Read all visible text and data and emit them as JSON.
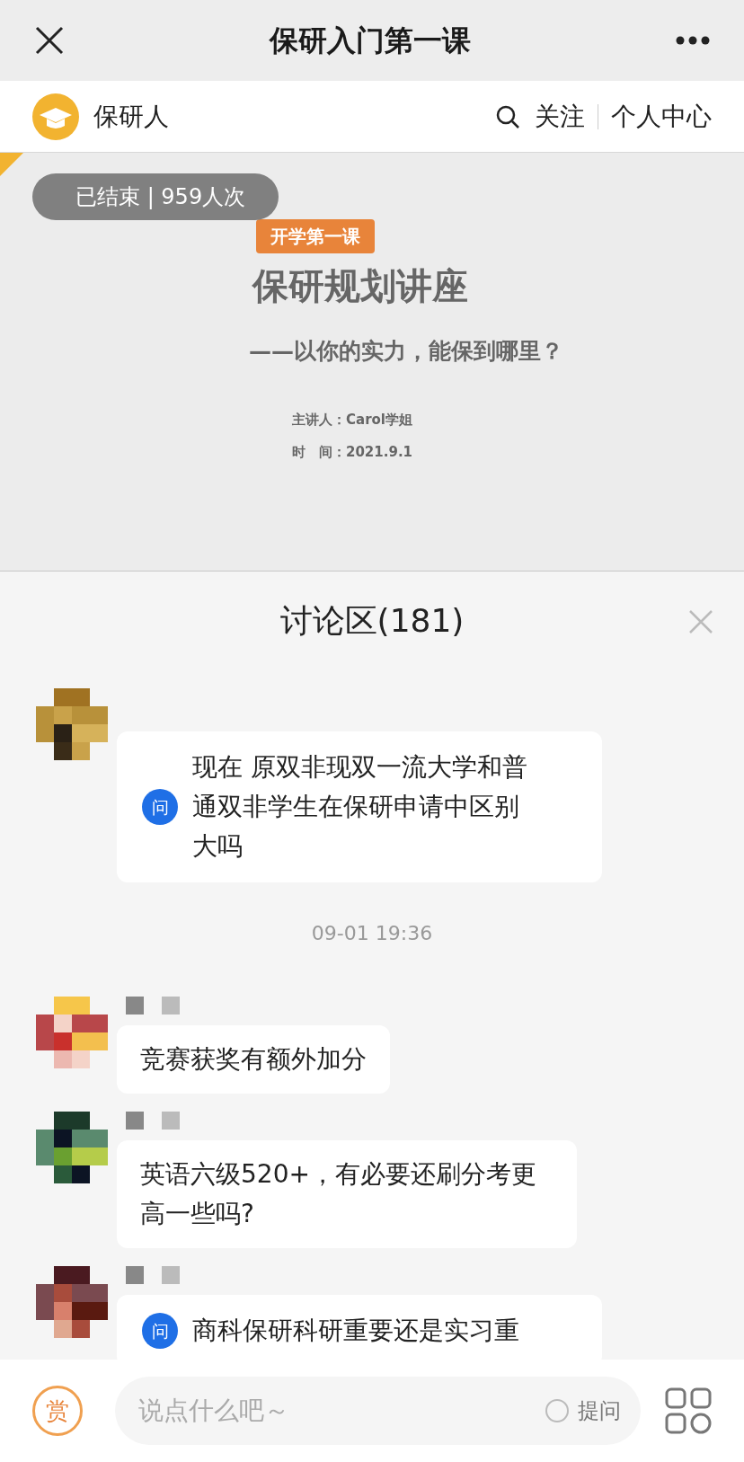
{
  "nav_bar": {
    "title": "保研入门第一课"
  },
  "channel_bar": {
    "name": "保研人",
    "follow": "关注",
    "profile": "个人中心"
  },
  "slide": {
    "status": "已结束 | 959人次",
    "tag": "开学第一课",
    "title": "保研规划讲座",
    "subtitle": "——以你的实力，能保到哪里？",
    "presenter": "主讲人：Carol学姐",
    "date": "时　间：2021.9.1"
  },
  "discussion": {
    "title": "讨论区(181)",
    "items": [
      {
        "kind": "message",
        "question": true,
        "badge": "问",
        "show_name": false,
        "text": "现在 原双非现双一流大学和普通双非学生在保研申请中区别大吗"
      },
      {
        "kind": "timestamp",
        "text": "09-01 19:36"
      },
      {
        "kind": "message",
        "question": false,
        "show_name": true,
        "text": "竞赛获奖有额外加分"
      },
      {
        "kind": "message",
        "question": false,
        "show_name": true,
        "text": "英语六级520+，有必要还刷分考更高一些吗?"
      },
      {
        "kind": "message",
        "question": true,
        "badge": "问",
        "show_name": true,
        "text": "商科保研科研重要还是实习重"
      }
    ]
  },
  "bottom_bar": {
    "reward": "赏",
    "placeholder": "说点什么吧～",
    "ask_option": {
      "label": "提问",
      "checked": false
    }
  }
}
